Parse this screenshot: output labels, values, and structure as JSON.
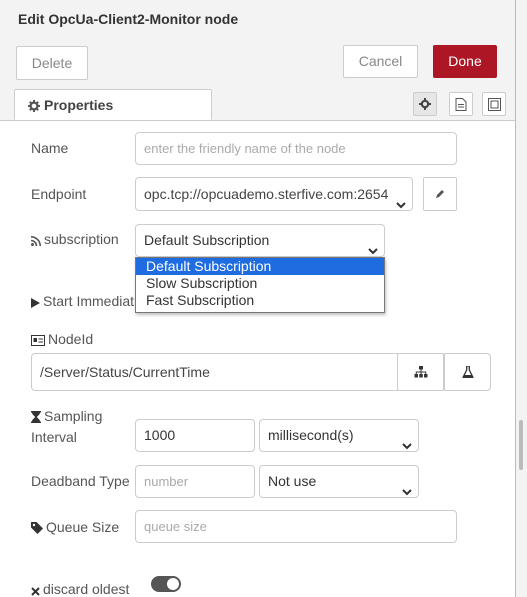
{
  "header": {
    "title": "Edit OpcUa-Client2-Monitor node"
  },
  "toolbar": {
    "delete_label": "Delete",
    "cancel_label": "Cancel",
    "done_label": "Done"
  },
  "tabs": {
    "properties_label": "Properties"
  },
  "form": {
    "name": {
      "label": "Name",
      "placeholder": "enter the friendly name of the node"
    },
    "endpoint": {
      "label": "Endpoint",
      "value": "opc.tcp://opcuademo.sterfive.com:2654"
    },
    "subscription": {
      "label": "subscription",
      "value": "Default Subscription",
      "options": [
        "Default Subscription",
        "Slow Subscription",
        "Fast Subscription"
      ]
    },
    "start_immediately": {
      "label": "Start Immediati"
    },
    "nodeid": {
      "label": "NodeId",
      "value": "/Server/Status/CurrentTime"
    },
    "sampling": {
      "label_line1": "Sampling",
      "label_line2": "Interval",
      "value": "1000",
      "unit": "millisecond(s)"
    },
    "deadband": {
      "label": "Deadband Type",
      "placeholder": "number",
      "type": "Not use"
    },
    "queue": {
      "label": "Queue Size",
      "placeholder": "queue size"
    },
    "discard": {
      "label": "discard oldest",
      "enabled": true
    }
  },
  "colors": {
    "accent": "#ad1625",
    "selection": "#1e6ce0"
  }
}
